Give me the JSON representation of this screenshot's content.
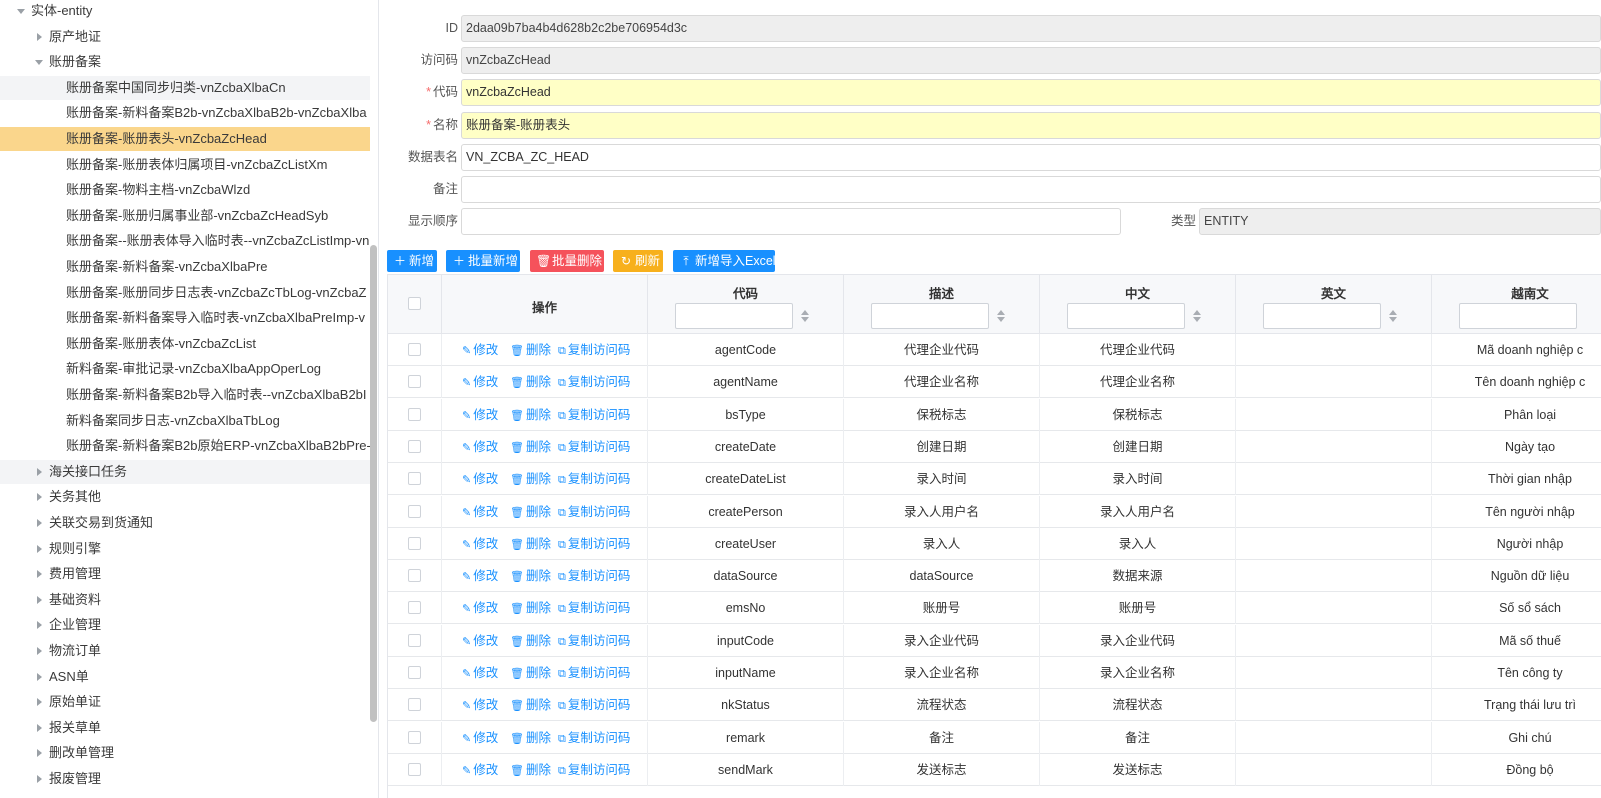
{
  "tree": {
    "root": "实体-entity",
    "groups_before": [
      "原产地证"
    ],
    "open_group": "账册备案",
    "open_children": [
      "账册备案中国同步归类-vnZcbaXlbaCn",
      "账册备案-新料备案B2b-vnZcbaXlbaB2b-vnZcbaXlba",
      "账册备案-账册表头-vnZcbaZcHead",
      "账册备案-账册表体归属项目-vnZcbaZcListXm",
      "账册备案-物料主档-vnZcbaWlzd",
      "账册备案-账册归属事业部-vnZcbaZcHeadSyb",
      "账册备案--账册表体导入临时表--vnZcbaZcListImp-vn",
      "账册备案-新料备案-vnZcbaXlbaPre",
      "账册备案-账册同步日志表-vnZcbaZcTbLog-vnZcbaZ",
      "账册备案-新料备案导入临时表-vnZcbaXlbaPreImp-v",
      "账册备案-账册表体-vnZcbaZcList",
      "新料备案-审批记录-vnZcbaXlbaAppOperLog",
      "账册备案-新料备案B2b导入临时表--vnZcbaXlbaB2bI",
      "新料备案同步日志-vnZcbaXlbaTbLog",
      "账册备案-新料备案B2b原始ERP-vnZcbaXlbaB2bPre-"
    ],
    "groups_after": [
      "海关接口任务",
      "关务其他",
      "关联交易到货通知",
      "规则引擎",
      "费用管理",
      "基础资料",
      "企业管理",
      "物流订单",
      "ASN单",
      "原始单证",
      "报关草单",
      "删改单管理",
      "报废管理"
    ]
  },
  "form": {
    "id_label": "ID",
    "id_value": "2daa09b7ba4b4d628b2c2be706954d3c",
    "access_label": "访问码",
    "access_value": "vnZcbaZcHead",
    "code_label": "代码",
    "code_value": "vnZcbaZcHead",
    "name_label": "名称",
    "name_value": "账册备案-账册表头",
    "table_label": "数据表名",
    "table_value": "VN_ZCBA_ZC_HEAD",
    "remark_label": "备注",
    "remark_value": "",
    "order_label": "显示顺序",
    "order_value": "",
    "type_label": "类型",
    "type_value": "ENTITY",
    "required_mark": "*"
  },
  "toolbar": {
    "add": "新增",
    "batch_add": "批量新增",
    "batch_delete": "批量删除",
    "refresh": "刷新",
    "import_excel": "新增导入Excel",
    "icons": {
      "add": "plus-icon",
      "batch_add": "plus-icon",
      "batch_delete": "trash-icon",
      "refresh": "refresh-icon",
      "import_excel": "upload-icon"
    },
    "colors": {
      "primary": "#1890ff",
      "danger": "#f5525b",
      "warning": "#f7b01c"
    }
  },
  "grid": {
    "columns": [
      "操作",
      "代码",
      "描述",
      "中文",
      "英文",
      "越南文"
    ],
    "actions": {
      "edit": "修改",
      "delete": "删除",
      "copy": "复制访问码"
    },
    "rows": [
      [
        "agentCode",
        "代理企业代码",
        "代理企业代码",
        "",
        "Mã doanh nghiệp c"
      ],
      [
        "agentName",
        "代理企业名称",
        "代理企业名称",
        "",
        "Tên doanh nghiệp c"
      ],
      [
        "bsType",
        "保税标志",
        "保税标志",
        "",
        "Phân loại"
      ],
      [
        "createDate",
        "创建日期",
        "创建日期",
        "",
        "Ngày tạo"
      ],
      [
        "createDateList",
        "录入时间",
        "录入时间",
        "",
        "Thời gian nhập"
      ],
      [
        "createPerson",
        "录入人用户名",
        "录入人用户名",
        "",
        "Tên người nhập"
      ],
      [
        "createUser",
        "录入人",
        "录入人",
        "",
        "Người nhập"
      ],
      [
        "dataSource",
        "dataSource",
        "数据来源",
        "",
        "Nguồn dữ liệu"
      ],
      [
        "emsNo",
        "账册号",
        "账册号",
        "",
        "Số sổ sách"
      ],
      [
        "inputCode",
        "录入企业代码",
        "录入企业代码",
        "",
        "Mã số thuế"
      ],
      [
        "inputName",
        "录入企业名称",
        "录入企业名称",
        "",
        "Tên công ty"
      ],
      [
        "nkStatus",
        "流程状态",
        "流程状态",
        "",
        "Trạng thái lưu trì"
      ],
      [
        "remark",
        "备注",
        "备注",
        "",
        "Ghi chú"
      ],
      [
        "sendMark",
        "发送标志",
        "发送标志",
        "",
        "Đồng bộ"
      ]
    ]
  }
}
